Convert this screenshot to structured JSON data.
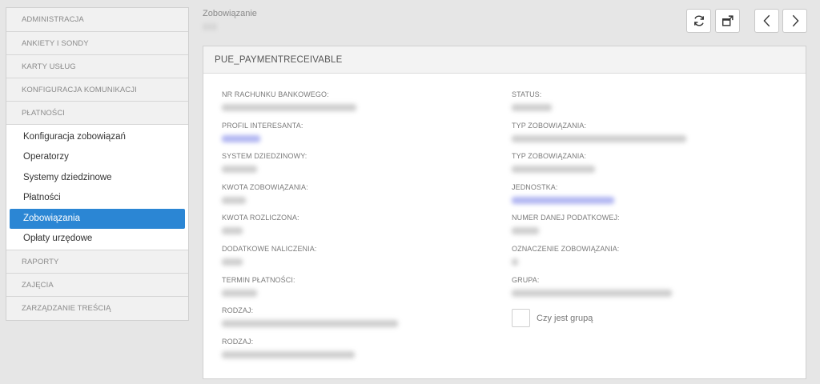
{
  "sidebar": {
    "sections_top": [
      {
        "label": "ADMINISTRACJA"
      },
      {
        "label": "ANKIETY I SONDY"
      },
      {
        "label": "KARTY USŁUG"
      },
      {
        "label": "KONFIGURACJA KOMUNIKACJI"
      },
      {
        "label": "PŁATNOŚCI"
      }
    ],
    "items": [
      {
        "label": "Konfiguracja zobowiązań"
      },
      {
        "label": "Operatorzy"
      },
      {
        "label": "Systemy dziedzinowe"
      },
      {
        "label": "Płatności"
      },
      {
        "label": "Zobowiązania"
      },
      {
        "label": "Opłaty urzędowe"
      }
    ],
    "active_item": "Zobowiązania",
    "active_color": "#2b86d4",
    "sections_bottom": [
      {
        "label": "RAPORTY"
      },
      {
        "label": "ZAJĘCIA"
      },
      {
        "label": "ZARZĄDZANIE TREŚCIĄ"
      }
    ]
  },
  "header": {
    "title": "Zobowiązanie",
    "icons": [
      "refresh-icon",
      "open-external-icon",
      "chevron-left-icon",
      "chevron-right-icon"
    ]
  },
  "panel": {
    "title": "PUE_PAYMENTRECEIVABLE",
    "left_fields": [
      {
        "label": "NR RACHUNKU BANKOWEGO:"
      },
      {
        "label": "PROFIL INTERESANTA:"
      },
      {
        "label": "SYSTEM DZIEDZINOWY:"
      },
      {
        "label": "KWOTA ZOBOWIĄZANIA:"
      },
      {
        "label": "KWOTA ROZLICZONA:"
      },
      {
        "label": "DODATKOWE NALICZENIA:"
      },
      {
        "label": "TERMIN PŁATNOŚCI:"
      },
      {
        "label": "RODZAJ:"
      },
      {
        "label": "RODZAJ:"
      }
    ],
    "right_fields": [
      {
        "label": "STATUS:"
      },
      {
        "label": "TYP ZOBOWIĄZANIA:"
      },
      {
        "label": "TYP ZOBOWIĄZANIA:"
      },
      {
        "label": "JEDNOSTKA:"
      },
      {
        "label": "NUMER DANEJ PODATKOWEJ:"
      },
      {
        "label": "OZNACZENIE ZOBOWIĄZANIA:"
      },
      {
        "label": "GRUPA:"
      }
    ],
    "checkbox_label": "Czy jest grupą",
    "checkbox_checked": false
  }
}
